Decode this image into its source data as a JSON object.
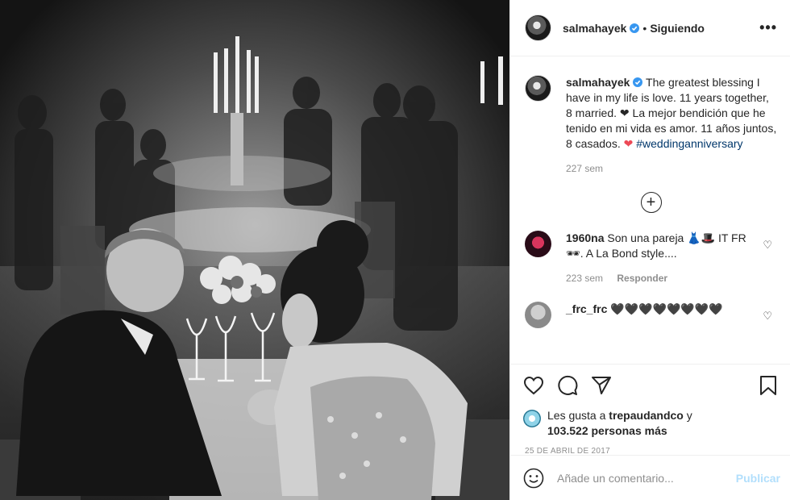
{
  "post": {
    "image_alt": "Fotografía en blanco y negro de una pareja en la mesa de una boda"
  },
  "header": {
    "username": "salmahayek",
    "separator": "•",
    "follow_label": "Siguiendo",
    "more_label": "•••"
  },
  "caption": {
    "username": "salmahayek",
    "text_1": "The greatest blessing I have in my life is love. 11 years together, 8 married.",
    "heart_1": "❤",
    "text_2": "La mejor bendición que he tenido en mi vida es amor. 11 años juntos, 8 casados.",
    "heart_2": "❤",
    "hashtag": "#weddinganniversary",
    "time": "227 sem"
  },
  "load_more_label": "+",
  "comments": [
    {
      "username": "1960na",
      "text": "Son una pareja 👗🎩 IT FR 🕶. A La Bond style....",
      "time": "223 sem",
      "reply_label": "Responder"
    },
    {
      "username": "_frc_frc",
      "text": "🖤🖤🖤🖤🖤🖤🖤🖤",
      "time": "",
      "reply_label": ""
    }
  ],
  "likes": {
    "prefix": "Les gusta a",
    "user": "trepaudandco",
    "connector": "y",
    "count": "103.522 personas más"
  },
  "date": "25 de abril de 2017",
  "add_comment": {
    "placeholder": "Añade un comentario...",
    "publish_label": "Publicar"
  },
  "colors": {
    "verified": "#3897f0",
    "heart": "#ed4956",
    "hashtag": "#00376b",
    "publish_disabled": "#b2dffc"
  }
}
